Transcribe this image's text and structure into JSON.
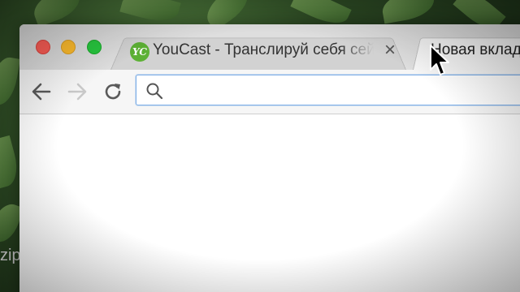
{
  "background": {
    "partial_text": "zip"
  },
  "window": {
    "tabs": [
      {
        "title": "YouCast - Транслируй себя сейчас",
        "favicon_text": "YC",
        "favicon_color": "#5db135",
        "close_icon": "×",
        "active": false
      },
      {
        "title": "Новая вкладка",
        "active": true
      }
    ],
    "toolbar": {
      "back_icon": "arrow-left-icon",
      "forward_icon": "arrow-right-icon",
      "reload_icon": "reload-icon",
      "omnibox": {
        "value": "",
        "placeholder": "",
        "icon": "search-icon",
        "accent": "#7eaee6"
      }
    }
  }
}
